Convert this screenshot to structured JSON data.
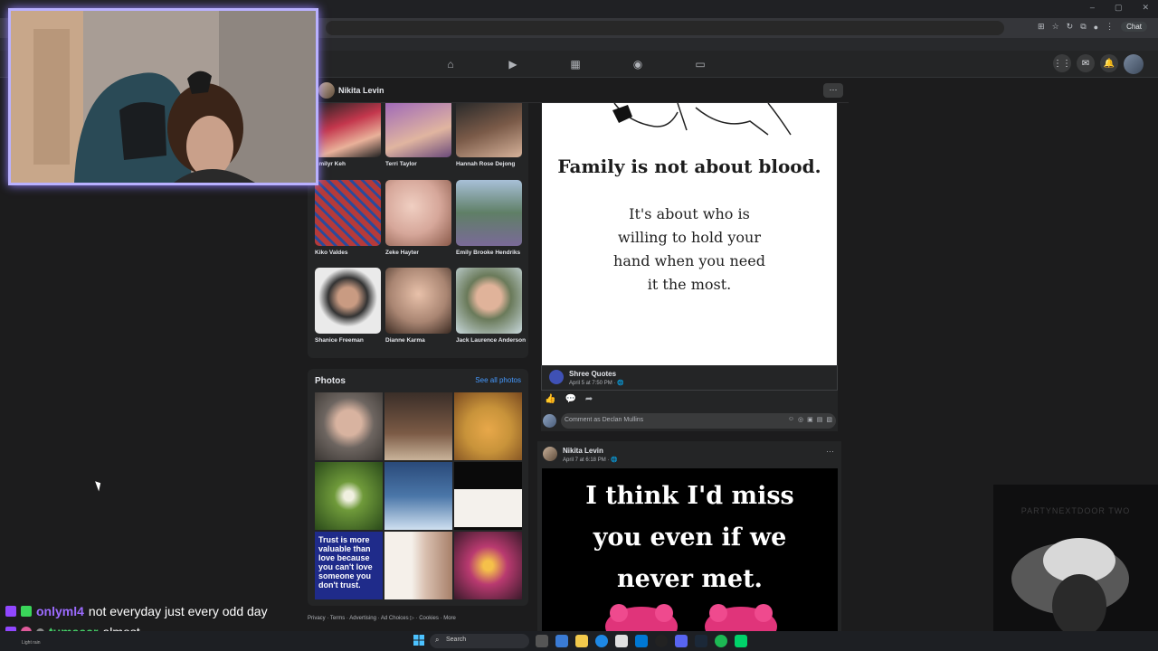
{
  "browser": {
    "chat_label": "Chat",
    "window_controls": [
      "–",
      "▢",
      "✕"
    ]
  },
  "profile": {
    "name": "Nikita Levin",
    "more": "···"
  },
  "friends": [
    {
      "name": "Emilyr Keh",
      "color": "#c4374d"
    },
    {
      "name": "Terri Taylor",
      "color": "#a06ab8"
    },
    {
      "name": "Hannah Rose Dejong",
      "color": "#7a5a48"
    },
    {
      "name": "Kiko Valdes",
      "color": "#b53a3a"
    },
    {
      "name": "Zeke Hayter",
      "color": "#d6a79a"
    },
    {
      "name": "Emily Brooke Hendriks",
      "color": "#5f7f66"
    },
    {
      "name": "Shanice Freeman",
      "color": "#e8e8e8"
    },
    {
      "name": "Dianne Karma",
      "color": "#a98572"
    },
    {
      "name": "Jack Laurence Anderson",
      "color": "#8fa7a8"
    }
  ],
  "photos": {
    "title": "Photos",
    "see_all": "See all photos",
    "colors": [
      "#6d6560",
      "#7b5a45",
      "#c8933a",
      "#6f9a3a",
      "#4a76a8",
      "#f4f1ec",
      "#1f2b8a",
      "#d9c0b0",
      "#b93a70"
    ],
    "trust_text": "Trust is more valuable than love because you can't love someone you don't trust."
  },
  "footer": "Privacy · Terms · Advertising · Ad Choices ▷ · Cookies · More",
  "post1": {
    "heading": "Family is not about blood.",
    "body_lines": [
      "It's about who is",
      "willing to hold your",
      "hand when you need",
      "it the most."
    ],
    "source_name": "Shree Quotes",
    "source_time": "April 5 at 7:50 PM · 🌐",
    "actions": [
      "👍",
      "💬",
      "➦"
    ],
    "comment_placeholder": "Comment as Declan Mullins",
    "comment_tools": [
      "☺",
      "◎",
      "▣",
      "▤",
      "▧"
    ]
  },
  "post2": {
    "author": "Nikita Levin",
    "time": "April 7 at 6:18 PM · 🌐",
    "more": "···",
    "image_lines": [
      "I think I'd miss",
      "you even if we",
      "never met."
    ]
  },
  "music": {
    "title": "PARTYNEXTDOOR TWO"
  },
  "chat": [
    {
      "user": "onlyml4",
      "user_color": "#9c6bff",
      "text": "not everyday just every odd day"
    },
    {
      "user": "tumaaar",
      "user_color": "#46d66b",
      "text": "almost"
    }
  ],
  "chat_extra": "Light rain",
  "taskbar": {
    "search": "Search"
  }
}
